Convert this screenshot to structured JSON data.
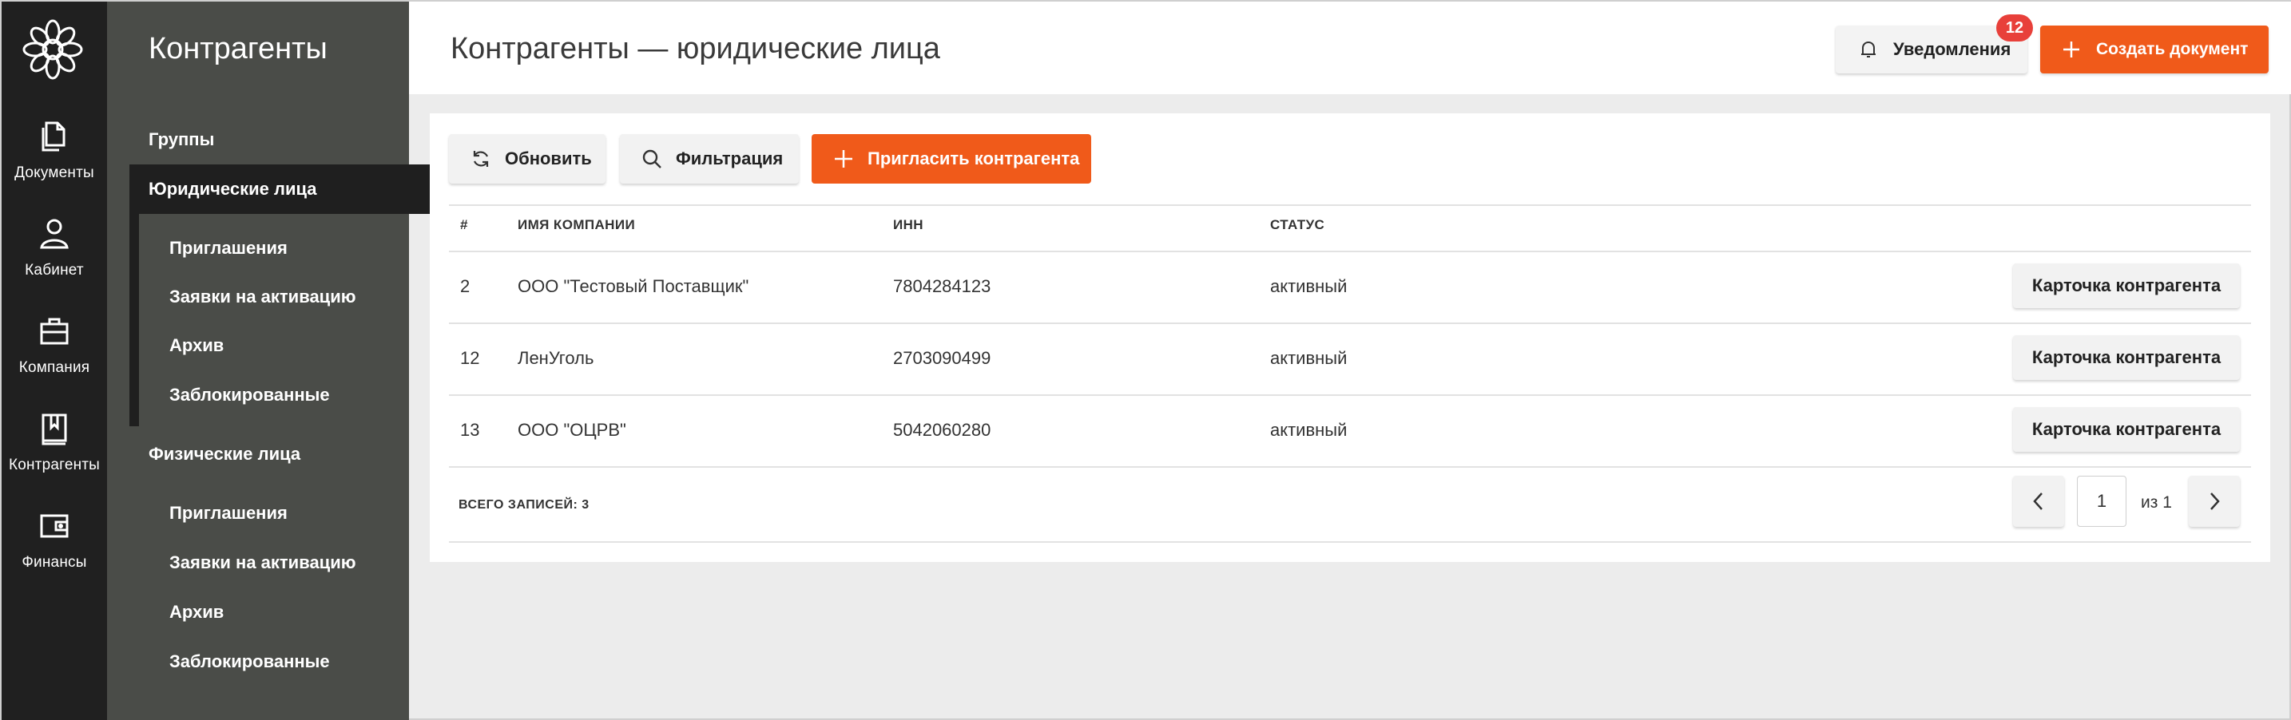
{
  "rail": {
    "items": [
      {
        "label": "Документы",
        "icon": "documents-icon"
      },
      {
        "label": "Кабинет",
        "icon": "user-icon"
      },
      {
        "label": "Компания",
        "icon": "briefcase-icon"
      },
      {
        "label": "Контрагенты",
        "icon": "bookmark-book-icon"
      },
      {
        "label": "Финансы",
        "icon": "wallet-icon"
      }
    ]
  },
  "subnav": {
    "title": "Контрагенты",
    "groups_label": "Группы",
    "legal_label": "Юридические лица",
    "legal_items": [
      "Приглашения",
      "Заявки на активацию",
      "Архив",
      "Заблокированные"
    ],
    "physical_label": "Физические лица",
    "physical_items": [
      "Приглашения",
      "Заявки на активацию",
      "Архив",
      "Заблокированные"
    ]
  },
  "header": {
    "title": "Контрагенты — юридические лица",
    "notifications_label": "Уведомления",
    "notifications_count": "12",
    "create_label": "Создать документ"
  },
  "toolbar": {
    "refresh_label": "Обновить",
    "filter_label": "Фильтрация",
    "invite_label": "Пригласить контрагента"
  },
  "table": {
    "headers": {
      "num": "#",
      "company": "ИМЯ КОМПАНИИ",
      "inn": "ИНН",
      "status": "СТАТУС"
    },
    "rows": [
      {
        "num": "2",
        "company": "ООО \"Тестовый Поставщик\"",
        "inn": "7804284123",
        "status": "активный",
        "action": "Карточка контрагента"
      },
      {
        "num": "12",
        "company": "ЛенУголь",
        "inn": "2703090499",
        "status": "активный",
        "action": "Карточка контрагента"
      },
      {
        "num": "13",
        "company": "ООО \"ОЦРВ\"",
        "inn": "5042060280",
        "status": "активный",
        "action": "Карточка контрагента"
      }
    ]
  },
  "pagination": {
    "total_label": "ВСЕГО ЗАПИСЕЙ: 3",
    "page": "1",
    "of_label": "из 1"
  },
  "colors": {
    "accent": "#f05a1a",
    "badge": "#e8403a",
    "rail_bg": "#202020",
    "subnav_bg": "#4a4c48"
  }
}
